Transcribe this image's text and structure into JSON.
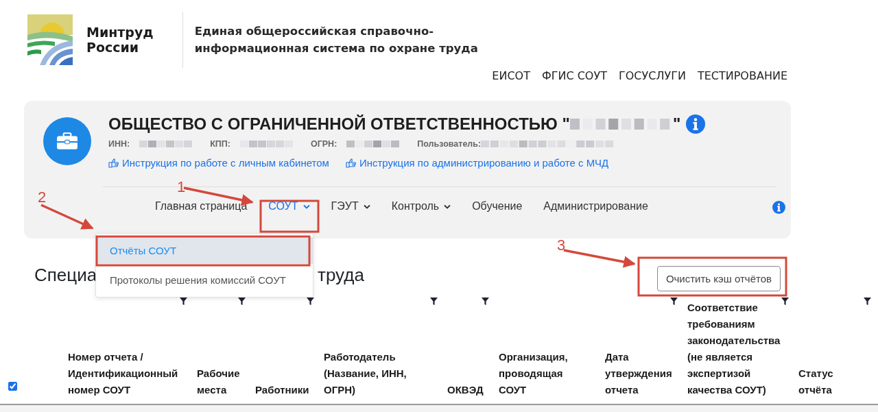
{
  "brand": {
    "name_lines": [
      "Минтруд",
      "России"
    ],
    "system_title_lines": [
      "Единая общероссийская справочно-",
      "информационная система по охране труда"
    ]
  },
  "top_links": [
    "ЕИСОТ",
    "ФГИС СОУТ",
    "ГОСУСЛУГИ",
    "ТЕСТИРОВАНИЕ"
  ],
  "organization": {
    "name_prefix": "ОБЩЕСТВО С ОГРАНИЧЕННОЙ ОТВЕТСТВЕННОСТЬЮ \"",
    "name_suffix": "\"",
    "fields": [
      {
        "label": "ИНН:"
      },
      {
        "label": "КПП:"
      },
      {
        "label": "ОГРН:"
      },
      {
        "label": "Пользователь:"
      }
    ],
    "links": [
      "Инструкция по работе с личным кабинетом",
      "Инструкция по администрированию и работе с МЧД"
    ]
  },
  "nav": [
    {
      "label": "Главная страница",
      "has_menu": false,
      "selected": false
    },
    {
      "label": "СОУТ",
      "has_menu": true,
      "selected": true
    },
    {
      "label": "ГЭУТ",
      "has_menu": true,
      "selected": false
    },
    {
      "label": "Контроль",
      "has_menu": true,
      "selected": false
    },
    {
      "label": "Обучение",
      "has_menu": false,
      "selected": false
    },
    {
      "label": "Администрирование",
      "has_menu": false,
      "selected": false
    }
  ],
  "dropdown": [
    {
      "label": "Отчёты СОУТ",
      "selected": true
    },
    {
      "label": "Протоколы решения комиссий СОУТ",
      "selected": false
    }
  ],
  "heading_visible_parts": [
    "Специа",
    "труда"
  ],
  "clear_cache_button": "Очистить кэш отчётов",
  "table": {
    "select_all_checked": true,
    "columns": [
      {
        "lines": [
          "Номер отчета /",
          "Идентификационный",
          "номер СОУТ"
        ],
        "filter": true
      },
      {
        "lines": [
          "Рабочие",
          "места"
        ],
        "filter": true
      },
      {
        "lines": [
          "Работники"
        ],
        "filter": true
      },
      {
        "lines": [
          "Работодатель",
          "(Название, ИНН,",
          "ОГРН)"
        ],
        "filter": true
      },
      {
        "lines": [
          "ОКВЭД"
        ],
        "filter": true
      },
      {
        "lines": [
          "Организация,",
          "проводящая",
          "СОУТ"
        ],
        "filter": false
      },
      {
        "lines": [
          "Дата",
          "утверждения",
          "отчета"
        ],
        "filter": true
      },
      {
        "lines": [
          "Соответствие",
          "требованиям",
          "законодательства",
          "(не является",
          "экспертизой",
          "качества СОУТ)"
        ],
        "filter": true
      },
      {
        "lines": [
          "Статус",
          "отчёта"
        ],
        "filter": true
      }
    ]
  },
  "annotations": [
    {
      "number": "1"
    },
    {
      "number": "2"
    },
    {
      "number": "3"
    }
  ]
}
